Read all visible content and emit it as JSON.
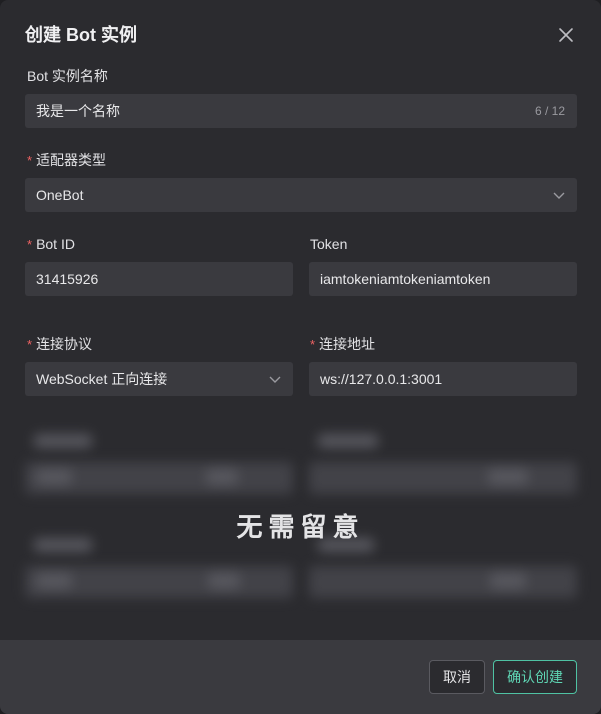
{
  "dialog": {
    "title": "创建 Bot 实例",
    "close_icon": "close-icon"
  },
  "form": {
    "name": {
      "label": "Bot 实例名称",
      "value": "我是一个名称",
      "counter": "6 / 12"
    },
    "adapter": {
      "label": "适配器类型",
      "value": "OneBot",
      "required": true
    },
    "bot_id": {
      "label": "Bot ID",
      "value": "31415926",
      "required": true
    },
    "token": {
      "label": "Token",
      "value": "iamtokeniamtokeniamtoken"
    },
    "protocol": {
      "label": "连接协议",
      "value": "WebSocket 正向连接",
      "required": true
    },
    "address": {
      "label": "连接地址",
      "value": "ws://127.0.0.1:3001",
      "required": true
    },
    "required_mark": "*"
  },
  "overlay": {
    "text": "无需留意"
  },
  "footer": {
    "cancel_label": "取消",
    "confirm_label": "确认创建"
  },
  "colors": {
    "accent": "#5fd6b4",
    "required": "#f06363",
    "background": "#2b2b2f",
    "field": "#3a3a3f"
  }
}
